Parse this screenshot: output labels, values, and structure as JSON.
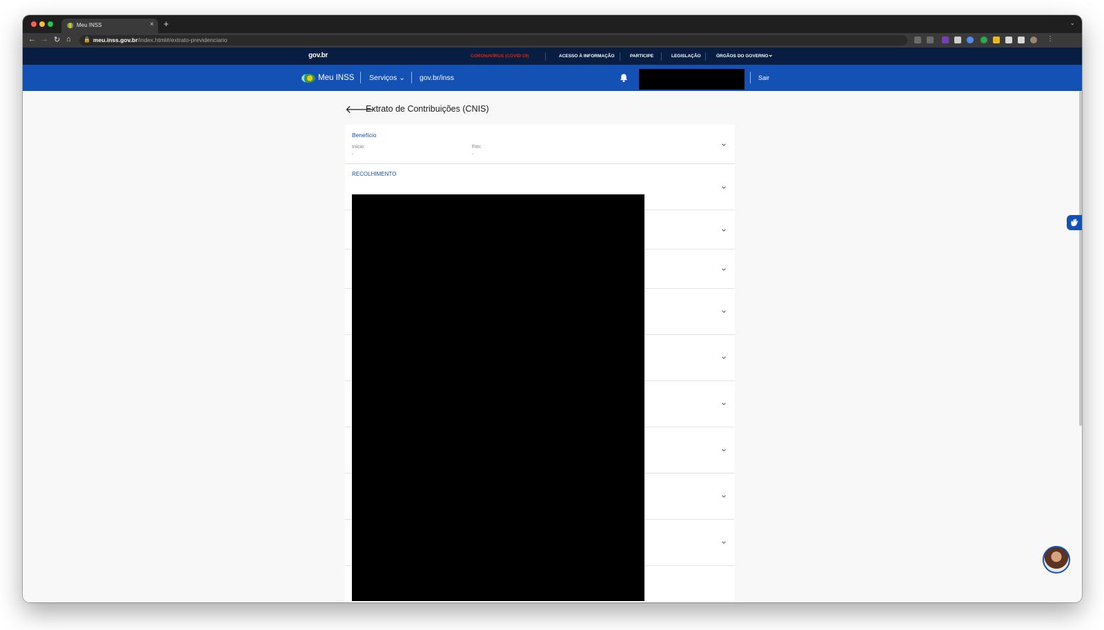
{
  "browser": {
    "tab_title": "Meu INSS",
    "tab_close": "×",
    "new_tab": "+",
    "tabs_menu": "⌄",
    "url_host": "meu.inss.gov.br",
    "url_path": "/index.html#/extrato-previdenciario",
    "nav_back": "←",
    "nav_forward": "→",
    "nav_reload": "↻",
    "nav_home": "⌂",
    "lock": "🔒",
    "menu": "⋮"
  },
  "gov_bar": {
    "logo": "gov.br",
    "links": [
      "CORONAVÍRUS (COVID-19)",
      "ACESSO À INFORMAÇÃO",
      "PARTICIPE",
      "LEGISLAÇÃO",
      "ÓRGÃOS DO GOVERNO"
    ],
    "dropdown_caret": "⌄",
    "covid_color": "#e52207"
  },
  "header": {
    "app_name": "Meu INSS",
    "services_label": "Serviços",
    "services_caret": "⌄",
    "link_label": "gov.br/inss",
    "logout_label": "Sair",
    "brand_color": "#1351b4"
  },
  "page": {
    "back_icon": "🡐",
    "title": "Extrato de Contribuições (CNIS)"
  },
  "beneficio": {
    "label": "Benefício",
    "inicio_label": "Início:",
    "inicio_value": "-",
    "fim_label": "Fim:",
    "fim_value": "-"
  },
  "recolhimento": {
    "label": "RECOLHIMENTO"
  }
}
